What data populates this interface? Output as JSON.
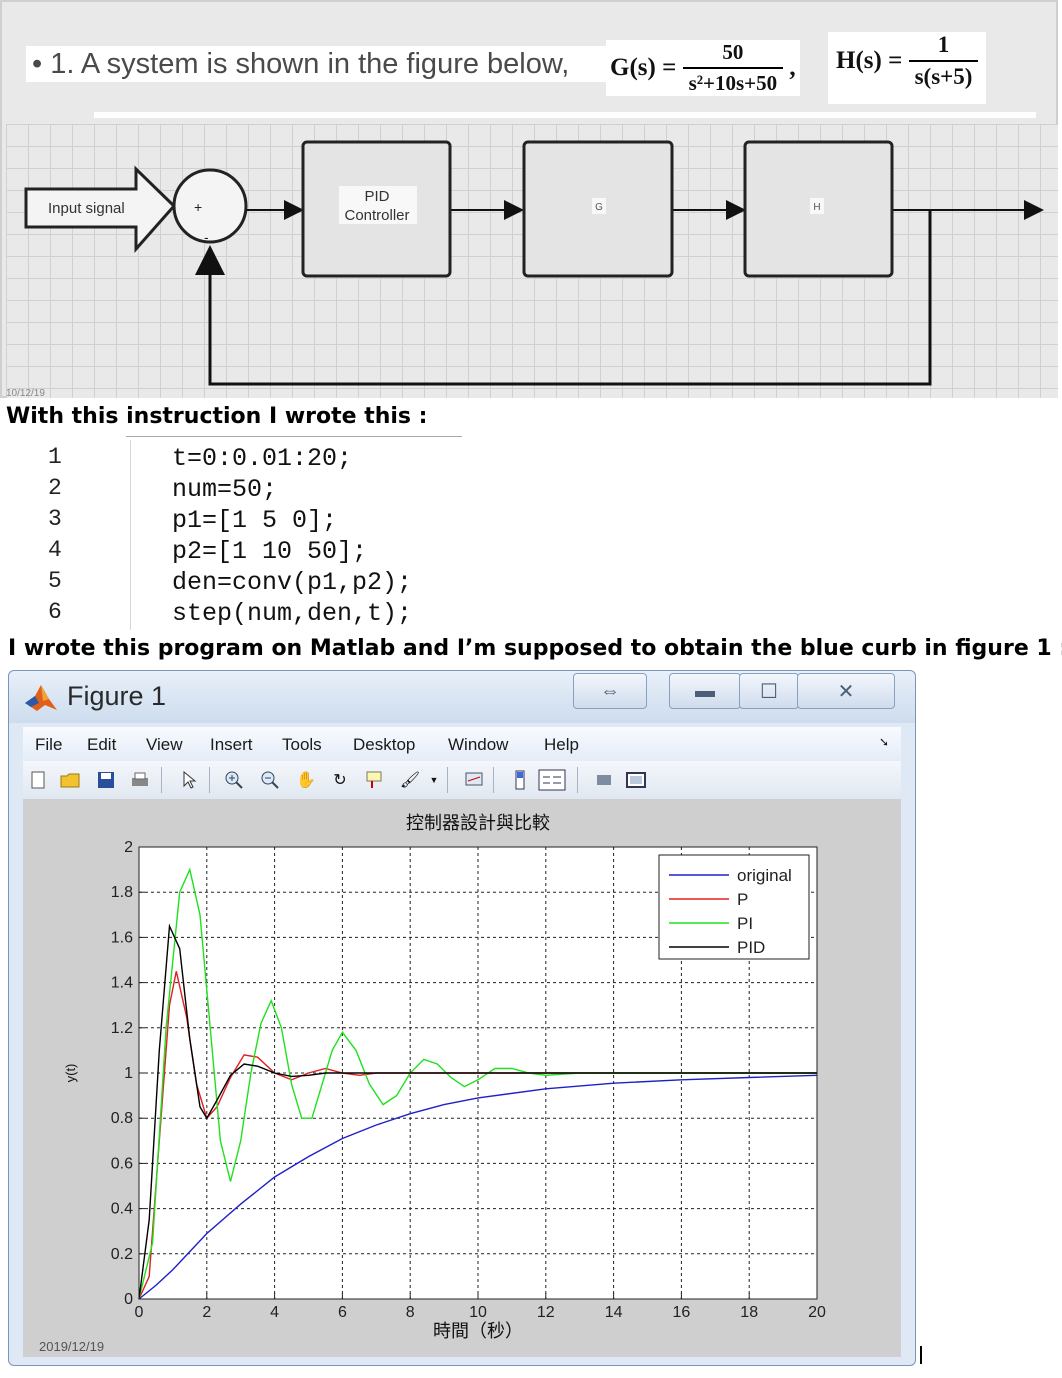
{
  "question": {
    "text": "• 1. A system is shown in the figure below,",
    "g_lhs": "G(s) =",
    "g_num": "50",
    "g_den": "s²+10s+50",
    "comma": ",",
    "h_lhs": "H(s) =",
    "h_num": "1",
    "h_den": "s(s+5)"
  },
  "diagram": {
    "input_label": "Input signal",
    "plus": "+",
    "minus": "-",
    "pid_label_1": "PID",
    "pid_label_2": "Controller",
    "g_label": "G",
    "h_label": "H",
    "slide_date": "10/12/19"
  },
  "instruction": "With this instruction I wrote this :",
  "code": {
    "line_numbers": [
      "1",
      "2",
      "3",
      "4",
      "5",
      "6"
    ],
    "lines": [
      "t=0:0.01:20;",
      "num=50;",
      "p1=[1 5 0];",
      "p2=[1 10 50];",
      "den=conv(p1,p2);",
      "step(num,den,t);"
    ]
  },
  "claim": "I wrote this program on Matlab and I’m supposed to obtain the blue curb in figure 1 :",
  "window": {
    "title": "Figure 1",
    "menu": [
      "File",
      "Edit",
      "View",
      "Insert",
      "Tools",
      "Desktop",
      "Window",
      "Help"
    ],
    "date": "2019/12/19"
  },
  "toolbar_icons": [
    "new-figure-icon",
    "open-file-icon",
    "save-icon",
    "print-icon",
    "pointer-icon",
    "zoom-in-icon",
    "zoom-out-icon",
    "pan-icon",
    "rotate-icon",
    "data-cursor-icon",
    "brush-icon",
    "link-plot-icon",
    "colorbar-icon",
    "legend-icon",
    "hide-plot-tools-icon",
    "show-plot-tools-icon"
  ],
  "colors": {
    "original": "#2020c8",
    "P": "#e02020",
    "PI": "#20e020",
    "PID": "#000000"
  },
  "chart_data": {
    "type": "line",
    "title": "控制器設計與比較",
    "xlabel": "時間（秒）",
    "ylabel": "y(t)",
    "xlim": [
      0,
      20
    ],
    "ylim": [
      0,
      2
    ],
    "xticks": [
      "0",
      "2",
      "4",
      "6",
      "8",
      "10",
      "12",
      "14",
      "16",
      "18",
      "20"
    ],
    "yticks": [
      "0",
      "0.2",
      "0.4",
      "0.6",
      "0.8",
      "1",
      "1.2",
      "1.4",
      "1.6",
      "1.8",
      "2"
    ],
    "grid": true,
    "legend_position": "top-right",
    "series": [
      {
        "name": "original",
        "x": [
          0,
          0.5,
          1,
          2,
          3,
          4,
          5,
          6,
          7,
          8,
          9,
          10,
          12,
          14,
          16,
          18,
          20
        ],
        "y": [
          0,
          0.06,
          0.13,
          0.29,
          0.42,
          0.54,
          0.63,
          0.71,
          0.77,
          0.82,
          0.86,
          0.89,
          0.93,
          0.955,
          0.97,
          0.98,
          0.99
        ]
      },
      {
        "name": "P",
        "x": [
          0,
          0.3,
          0.6,
          0.9,
          1.1,
          1.4,
          1.7,
          2.0,
          2.3,
          2.7,
          3.1,
          3.5,
          4,
          4.5,
          5,
          5.5,
          6,
          6.5,
          7,
          8,
          10,
          12,
          14,
          16,
          18,
          20
        ],
        "y": [
          0,
          0.1,
          0.7,
          1.3,
          1.45,
          1.25,
          0.95,
          0.8,
          0.85,
          0.98,
          1.08,
          1.07,
          1.0,
          0.97,
          1.0,
          1.02,
          1.0,
          0.99,
          1.0,
          1.0,
          1.0,
          1.0,
          1.0,
          1.0,
          1.0,
          1.0
        ]
      },
      {
        "name": "PI",
        "x": [
          0,
          0.4,
          0.8,
          1.2,
          1.5,
          1.8,
          2.1,
          2.4,
          2.7,
          3.0,
          3.3,
          3.6,
          3.9,
          4.2,
          4.5,
          4.8,
          5.1,
          5.4,
          5.7,
          6.0,
          6.4,
          6.8,
          7.2,
          7.6,
          8.0,
          8.4,
          8.8,
          9.2,
          9.6,
          10,
          10.5,
          11,
          11.5,
          12,
          13,
          14,
          16,
          18,
          20
        ],
        "y": [
          0,
          0.25,
          1.2,
          1.8,
          1.9,
          1.7,
          1.2,
          0.7,
          0.52,
          0.7,
          1.0,
          1.22,
          1.32,
          1.2,
          0.95,
          0.8,
          0.8,
          0.95,
          1.1,
          1.18,
          1.1,
          0.95,
          0.86,
          0.9,
          1.0,
          1.06,
          1.04,
          0.98,
          0.94,
          0.97,
          1.02,
          1.02,
          1.0,
          0.99,
          1.0,
          1.0,
          1.0,
          1.0,
          1.0
        ]
      },
      {
        "name": "PID",
        "x": [
          0,
          0.3,
          0.6,
          0.9,
          1.2,
          1.5,
          1.8,
          2.0,
          2.3,
          2.7,
          3.1,
          3.5,
          4,
          4.5,
          5,
          5.5,
          6,
          7,
          8,
          10,
          12,
          14,
          16,
          18,
          20
        ],
        "y": [
          0,
          0.35,
          1.1,
          1.65,
          1.55,
          1.15,
          0.85,
          0.8,
          0.88,
          0.99,
          1.04,
          1.03,
          1.0,
          0.985,
          0.99,
          1.0,
          1.0,
          1.0,
          1.0,
          1.0,
          1.0,
          1.0,
          1.0,
          1.0,
          1.0
        ]
      }
    ]
  }
}
